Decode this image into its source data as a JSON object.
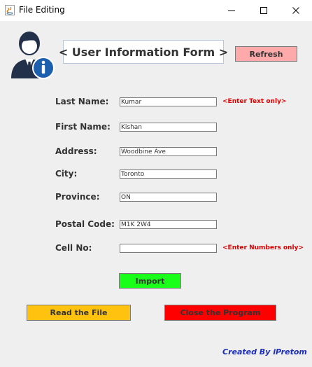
{
  "window": {
    "title": "File Editing",
    "controls": {
      "minimize_icon": "minimize-icon",
      "maximize_icon": "maximize-icon",
      "close_icon": "close-icon"
    }
  },
  "header": {
    "avatar_icon": "user-info-icon",
    "heading": "< User Information Form >",
    "refresh_label": "Refresh",
    "refresh_color": "#ffaaaa"
  },
  "form": {
    "fields": [
      {
        "label": "Last Name:",
        "value": "Kumar"
      },
      {
        "label": "First Name:",
        "value": "Kishan"
      },
      {
        "label": "Address:",
        "value": "Woodbine Ave"
      },
      {
        "label": "City:",
        "value": "Toronto"
      },
      {
        "label": "Province:",
        "value": "ON"
      },
      {
        "label": "Postal Code:",
        "value": "M1K 2W4"
      },
      {
        "label": "Cell No:",
        "value": ""
      }
    ],
    "hints": {
      "last_name": "<Enter Text only>",
      "cell_no": "<Enter Numbers only>"
    }
  },
  "actions": {
    "import_label": "Import",
    "import_color": "#1aff1a",
    "read_label": "Read the File",
    "read_color": "#ffc20e",
    "close_label": "Close the Program",
    "close_color": "#ff0000"
  },
  "footer": {
    "credit": "Created By iPretom"
  }
}
